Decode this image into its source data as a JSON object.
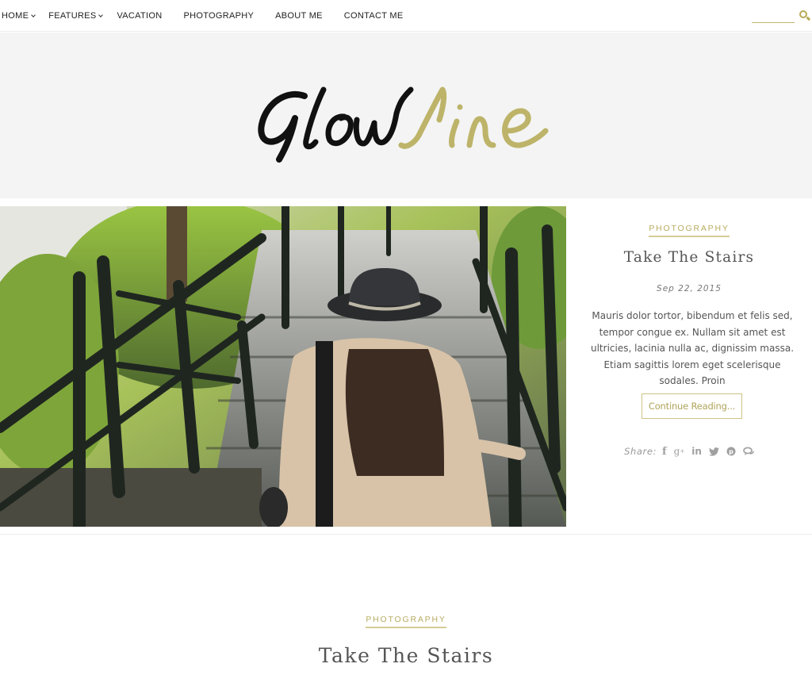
{
  "nav": {
    "items": [
      {
        "label": "HOME",
        "has_dropdown": true
      },
      {
        "label": "FEATURES",
        "has_dropdown": true
      },
      {
        "label": "VACATION",
        "has_dropdown": false
      },
      {
        "label": "PHOTOGRAPHY",
        "has_dropdown": false
      },
      {
        "label": "ABOUT ME",
        "has_dropdown": false
      },
      {
        "label": "CONTACT ME",
        "has_dropdown": false
      }
    ],
    "search": {
      "value": "",
      "placeholder": "",
      "icon": "search-icon"
    }
  },
  "header": {
    "logo_part1": "Glow",
    "logo_part2": "line",
    "logo_color_1": "#111111",
    "logo_color_2": "#bdb46a",
    "background": "#f4f4f4"
  },
  "featured_post": {
    "category": "PHOTOGRAPHY",
    "title": "Take The Stairs",
    "date": "Sep 22, 2015",
    "excerpt": "Mauris dolor tortor, bibendum et felis sed, tempor congue ex. Nullam sit amet est ultricies, lacinia nulla ac, dignissim massa. Etiam sagittis lorem eget scelerisque sodales. Proin",
    "continue_label": "Continue Reading...",
    "image_alt": "Woman in a black hat walking down outdoor stairs with iron railings",
    "share": {
      "label": "Share:",
      "icons": [
        {
          "name": "facebook-icon",
          "glyph": "f"
        },
        {
          "name": "google-plus-icon",
          "glyph": "g+"
        },
        {
          "name": "linkedin-icon",
          "glyph": "in"
        },
        {
          "name": "twitter-icon",
          "glyph": "t"
        },
        {
          "name": "pinterest-icon",
          "glyph": "p"
        },
        {
          "name": "comments-icon",
          "glyph": "c"
        }
      ]
    }
  },
  "second_post": {
    "category": "PHOTOGRAPHY",
    "title": "Take The Stairs"
  },
  "colors": {
    "accent": "#b8ac62",
    "accent_light": "#d6cc95",
    "text": "#555555"
  }
}
